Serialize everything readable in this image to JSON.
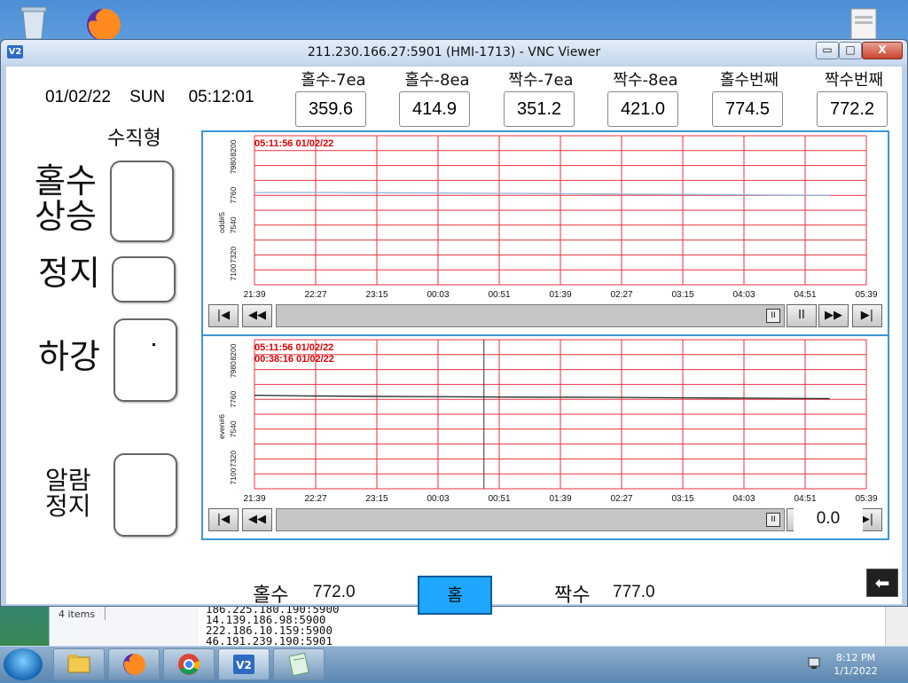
{
  "window": {
    "title": "211.230.166.27:5901 (HMI-1713) - VNC Viewer",
    "app_icon": "V2",
    "controls": {
      "minimize": "▭",
      "maximize": "□",
      "close": "X"
    }
  },
  "hmi": {
    "datetime": "01/02/22    SUN     05:12:01",
    "tags": [
      {
        "label": "홀수-7ea",
        "value": "359.6"
      },
      {
        "label": "홀수-8ea",
        "value": "414.9"
      },
      {
        "label": "짝수-7ea",
        "value": "351.2"
      },
      {
        "label": "짝수-8ea",
        "value": "421.0"
      },
      {
        "label": "홀수번째",
        "value": "774.5"
      },
      {
        "label": "짝수번째",
        "value": "772.2"
      }
    ],
    "vertical_type_label": "수직형",
    "side_controls": {
      "up_label_line1": "홀수",
      "up_label_line2": "상승",
      "stop_label": "정지",
      "down_label": "하강",
      "alarm_label_line1": "알람",
      "alarm_label_line2": "정지"
    },
    "trends": [
      {
        "y_axis_label": "odd#5",
        "y_ticks": [
          "7100",
          "7320",
          "7540",
          "7760",
          "7980",
          "8200"
        ],
        "x_ticks": [
          "21:39",
          "22:27",
          "23:15",
          "00:03",
          "00:51",
          "01:39",
          "02:27",
          "03:15",
          "04:03",
          "04:51",
          "05:39"
        ],
        "timestamps": [
          "05:11:56  01/02/22"
        ],
        "line_color": "#8fb3dd",
        "series_values": [
          7780,
          7781,
          7779,
          7778,
          7775,
          7773,
          7770,
          7768,
          7765,
          7762,
          7760
        ]
      },
      {
        "y_axis_label": "even#6",
        "y_ticks": [
          "7100",
          "7320",
          "7540",
          "7760",
          "7980",
          "8200"
        ],
        "x_ticks": [
          "21:39",
          "22:27",
          "23:15",
          "00:03",
          "00:51",
          "01:39",
          "02:27",
          "03:15",
          "04:03",
          "04:51",
          "05:39"
        ],
        "timestamps": [
          "05:11:56  01/02/22",
          "00:38:16  01/02/22"
        ],
        "line_color": "#222222",
        "series_values": [
          7790,
          7785,
          7782,
          7780,
          7778,
          7776,
          7775,
          7772,
          7770,
          7768,
          7765
        ]
      }
    ],
    "chart_controls": {
      "first": "|◀",
      "prev": "◀◀",
      "thumb": "II",
      "pause": "II",
      "next": "▶▶",
      "last": "▶|"
    },
    "overlay_value": "0.0",
    "bottom": {
      "odd_label": "홀수",
      "odd_value": "772.0",
      "home_label": "홈",
      "even_label": "짝수",
      "even_value": "777.0"
    },
    "back_arrow": "⬅"
  },
  "background": {
    "explorer_status": "4 items",
    "console_lines": [
      "186.225.180.190:5900",
      "14.139.186.98:5900",
      "222.186.10.159:5900",
      "46.191.239.190:5901"
    ]
  },
  "taskbar": {
    "time": "8:12 PM",
    "date": "1/1/2022"
  },
  "colors": {
    "grid_line": "#e8323f",
    "timestamp": "#e00000",
    "panel_border": "#3d97d3",
    "home_button": "#1fa6ff"
  }
}
